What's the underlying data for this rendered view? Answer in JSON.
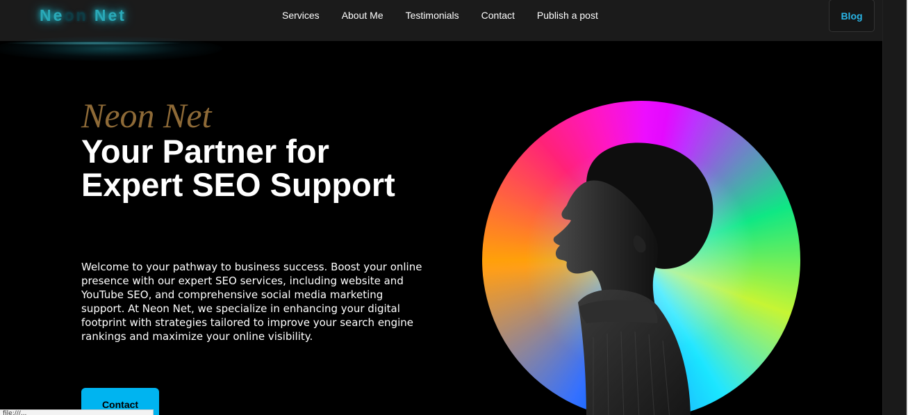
{
  "nav": {
    "logo": {
      "part1": "Ne",
      "part2": "on",
      "part3": " Net"
    },
    "links": [
      "Services",
      "About Me",
      "Testimonials",
      "Contact",
      "Publish a post"
    ],
    "blog_label": "Blog"
  },
  "hero": {
    "brand": "Neon Net",
    "title": "Your Partner for Expert SEO Support",
    "description": "Welcome to your pathway to business success. Boost your online presence with our expert SEO services, including website and YouTube SEO, and comprehensive social media marketing support. At Neon Net, we specialize in enhancing your digital footprint with strategies tailored to improve your search engine rankings and maximize your online visibility.",
    "contact_label": "Contact"
  },
  "status": {
    "text": "file:///..."
  },
  "colors": {
    "accent": "#00b4f0",
    "logo_glow": "#2aa9b8",
    "brand_gold": "#8e6a37",
    "blog_text": "#29b6e8"
  },
  "icons": {
    "hero_image": "person-profile-on-gradient-orb"
  }
}
